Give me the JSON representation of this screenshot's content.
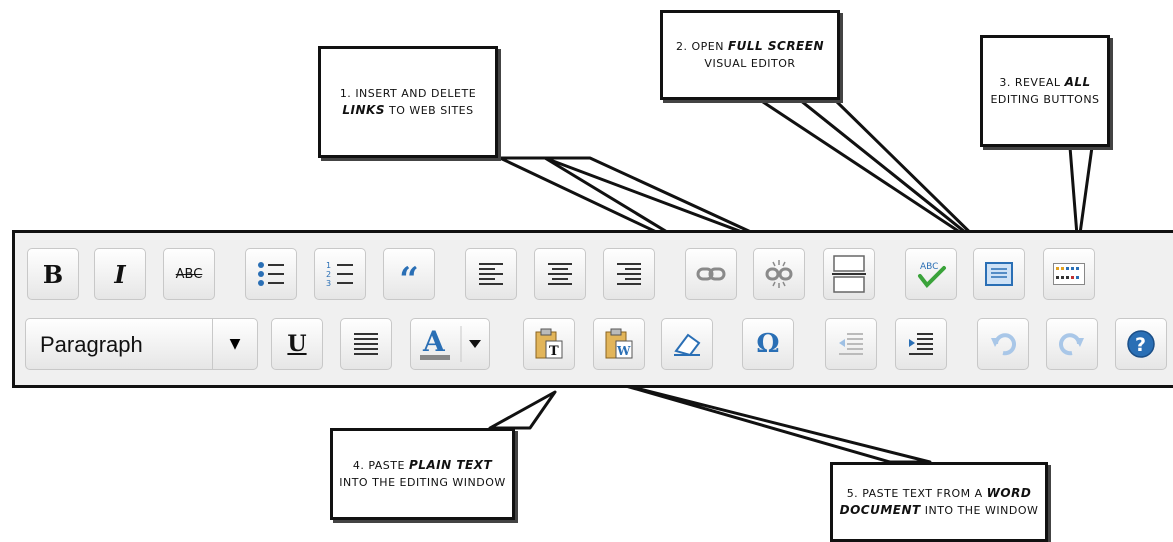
{
  "callouts": [
    {
      "id": "1",
      "num": "1.",
      "pre": "INSERT AND DELETE ",
      "em": "LINKS",
      "post": " TO WEB SITES"
    },
    {
      "id": "2",
      "num": "2.",
      "pre": "OPEN ",
      "em": "FULL SCREEN",
      "post": " VISUAL EDITOR"
    },
    {
      "id": "3",
      "num": "3.",
      "pre": "REVEAL ",
      "em": "ALL",
      "post": " EDITING BUTTONS"
    },
    {
      "id": "4",
      "num": "4.",
      "pre": "PASTE ",
      "em": "PLAIN TEXT",
      "post": " INTO THE EDITING WINDOW"
    },
    {
      "id": "5",
      "num": "5.",
      "pre": "PASTE TEXT FROM A ",
      "em": "WORD DOCUMENT",
      "post": " INTO THE WINDOW"
    }
  ],
  "toolbar": {
    "row1": [
      {
        "name": "bold-button",
        "glyph": "B"
      },
      {
        "name": "italic-button",
        "glyph": "I"
      },
      {
        "name": "strikethrough-button",
        "glyph": "ABC"
      },
      {
        "name": "bullet-list-button",
        "glyph": "•≡"
      },
      {
        "name": "numbered-list-button",
        "glyph": "1≡"
      },
      {
        "name": "blockquote-button",
        "glyph": "“"
      },
      {
        "name": "align-left-button",
        "glyph": "≡"
      },
      {
        "name": "align-center-button",
        "glyph": "≡"
      },
      {
        "name": "align-right-button",
        "glyph": "≡"
      },
      {
        "name": "insert-link-button",
        "glyph": "link"
      },
      {
        "name": "remove-link-button",
        "glyph": "unlink"
      },
      {
        "name": "insert-more-tag-button",
        "glyph": "more"
      },
      {
        "name": "spellcheck-button",
        "glyph": "ABC"
      },
      {
        "name": "fullscreen-button",
        "glyph": "full"
      },
      {
        "name": "kitchen-sink-button",
        "glyph": "kitchen"
      }
    ],
    "format_select": "Paragraph",
    "row2": [
      {
        "name": "underline-button",
        "glyph": "U"
      },
      {
        "name": "justify-button",
        "glyph": "≡"
      },
      {
        "name": "text-color-button",
        "glyph": "A"
      },
      {
        "name": "paste-plain-text-button",
        "glyph": "T"
      },
      {
        "name": "paste-from-word-button",
        "glyph": "W"
      },
      {
        "name": "clear-formatting-button",
        "glyph": "eraser"
      },
      {
        "name": "special-character-button",
        "glyph": "Ω"
      },
      {
        "name": "outdent-button",
        "glyph": "outdent"
      },
      {
        "name": "indent-button",
        "glyph": "indent"
      },
      {
        "name": "undo-button",
        "glyph": "undo"
      },
      {
        "name": "redo-button",
        "glyph": "redo"
      },
      {
        "name": "help-button",
        "glyph": "?"
      }
    ],
    "colors": {
      "border": "#111111",
      "button_bg": "#f4f4f4",
      "accent_blue": "#2a6fb5",
      "check_green": "#3aa33a"
    }
  }
}
